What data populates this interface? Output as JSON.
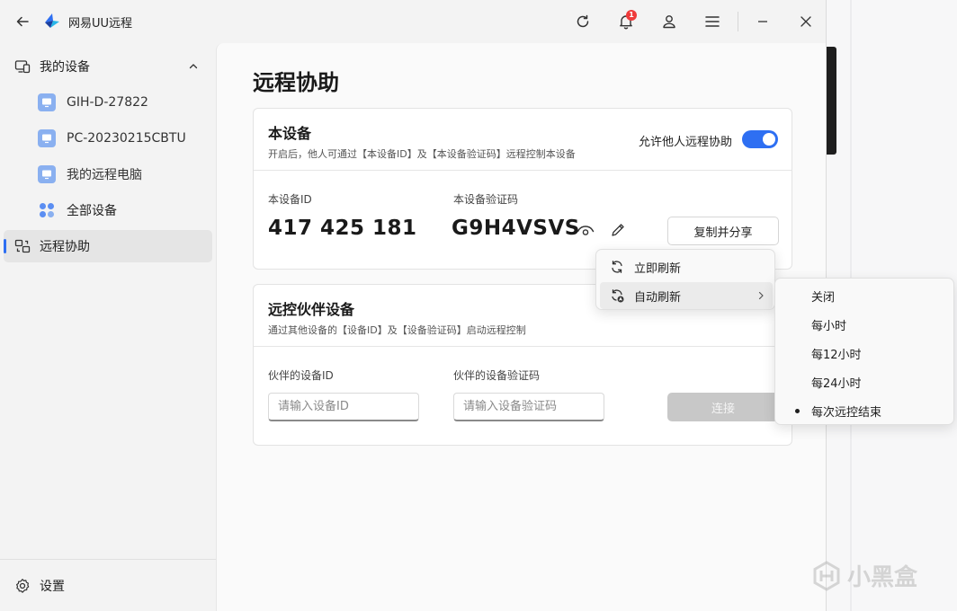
{
  "app": {
    "title": "网易UU远程",
    "notification_count": "1"
  },
  "sidebar": {
    "group_label": "我的设备",
    "devices": [
      {
        "label": "GIH-D-27822"
      },
      {
        "label": "PC-20230215CBTU"
      },
      {
        "label": "我的远程电脑"
      }
    ],
    "all_devices_label": "全部设备",
    "remote_assist_label": "远程协助",
    "settings_label": "设置"
  },
  "main": {
    "page_title": "远程协助",
    "this_device": {
      "title": "本设备",
      "subtitle": "开启后，他人可通过【本设备ID】及【本设备验证码】远程控制本设备",
      "toggle_label": "允许他人远程协助",
      "toggle_on": true,
      "id_label": "本设备ID",
      "id_value": "417 425 181",
      "code_label": "本设备验证码",
      "code_value": "G9H4VSVS",
      "copy_button": "复制并分享"
    },
    "partner": {
      "title": "远控伙伴设备",
      "subtitle": "通过其他设备的【设备ID】及【设备验证码】启动远程控制",
      "id_label": "伙伴的设备ID",
      "id_placeholder": "请输入设备ID",
      "code_label": "伙伴的设备验证码",
      "code_placeholder": "请输入设备验证码",
      "connect_button": "连接"
    }
  },
  "refresh_menu": {
    "items": [
      {
        "label": "立即刷新"
      },
      {
        "label": "自动刷新"
      }
    ]
  },
  "auto_refresh_menu": {
    "options": [
      "关闭",
      "每小时",
      "每12小时",
      "每24小时",
      "每次远控结束"
    ],
    "selected": "每次远控结束"
  },
  "watermark": {
    "text": "小黑盒"
  },
  "colors": {
    "accent": "#2e6ff2",
    "badge": "#ef3b3b"
  }
}
